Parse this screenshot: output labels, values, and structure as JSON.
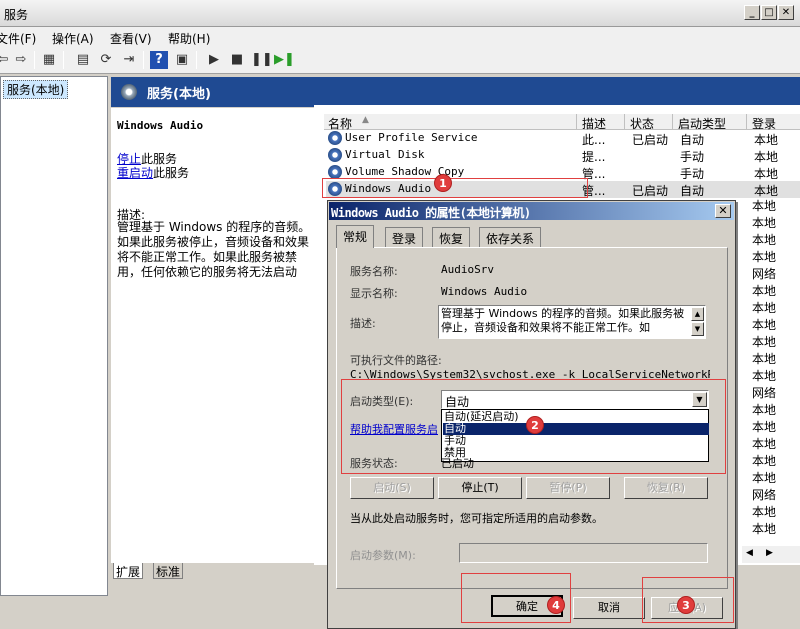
{
  "window": {
    "title": "服务"
  },
  "menu": [
    "文件(F)",
    "操作(A)",
    "查看(V)",
    "帮助(H)"
  ],
  "toolbar": {
    "icons": [
      "back-arrow-icon",
      "forward-arrow-icon",
      "console-tree-icon",
      "properties-icon",
      "refresh-icon",
      "export-icon",
      "help-icon",
      "console-icon",
      "play-icon",
      "stop-icon",
      "pause-icon",
      "restart-icon"
    ]
  },
  "tree": {
    "selected": "服务(本地)"
  },
  "panel": {
    "title": "服务(本地)"
  },
  "desc": {
    "service_name": "Windows Audio",
    "stop_link": "停止",
    "stop_suffix": "此服务",
    "restart_link": "重启动",
    "restart_suffix": "此服务",
    "desc_label": "描述:",
    "desc_text": "管理基于 Windows 的程序的音频。如果此服务被停止，音频设备和效果将不能正常工作。如果此服务被禁用，任何依赖它的服务将无法启动"
  },
  "list": {
    "columns": [
      "名称",
      "描述",
      "状态",
      "启动类型",
      "登录"
    ],
    "rows": [
      {
        "name": "User Profile Service",
        "desc": "此...",
        "status": "已启动",
        "startup": "自动",
        "logon": "本地"
      },
      {
        "name": "Virtual Disk",
        "desc": "提...",
        "status": "",
        "startup": "手动",
        "logon": "本地"
      },
      {
        "name": "Volume Shadow Copy",
        "desc": "管...",
        "status": "",
        "startup": "手动",
        "logon": "本地"
      },
      {
        "name": "Windows Audio",
        "desc": "管...",
        "status": "已启动",
        "startup": "自动",
        "logon": "本地"
      }
    ],
    "right_column": [
      "本地",
      "本地",
      "本地",
      "本地",
      "网络",
      "本地",
      "本地",
      "本地",
      "本地",
      "本地",
      "本地",
      "网络",
      "本地",
      "本地",
      "本地",
      "本地",
      "本地",
      "网络",
      "本地",
      "本地"
    ]
  },
  "bottom_tabs": [
    "扩展",
    "标准"
  ],
  "dialog": {
    "title": "Windows Audio 的属性(本地计算机)",
    "tabs": [
      "常规",
      "登录",
      "恢复",
      "依存关系"
    ],
    "service_name_label": "服务名称:",
    "service_name_value": "AudioSrv",
    "display_name_label": "显示名称:",
    "display_name_value": "Windows Audio",
    "description_label": "描述:",
    "description_value": "管理基于 Windows 的程序的音频。如果此服务被停止，音频设备和效果将不能正常工作。如",
    "exe_path_label": "可执行文件的路径:",
    "exe_path_value": "C:\\Windows\\System32\\svchost.exe -k LocalServiceNetworkRestri",
    "startup_type_label": "启动类型(E):",
    "startup_type_value": "自动",
    "startup_options": [
      "自动(延迟启动)",
      "自动",
      "手动",
      "禁用"
    ],
    "help_link": "帮助我配置服务启",
    "service_status_label": "服务状态:",
    "service_status_value": "已启动",
    "btn_start": "启动(S)",
    "btn_stop": "停止(T)",
    "btn_pause": "暂停(P)",
    "btn_resume": "恢复(R)",
    "start_params_note": "当从此处启动服务时，您可指定所适用的启动参数。",
    "start_params_label": "启动参数(M):",
    "ok": "确定",
    "cancel": "取消",
    "apply": "应用(A)"
  },
  "annotations": [
    "1",
    "2",
    "3",
    "4"
  ],
  "colors": {
    "header_bg": "#1f4a92",
    "dialog_title_start": "#0a246a",
    "badge": "#e03c3c",
    "highlight_box": "#e04040"
  }
}
